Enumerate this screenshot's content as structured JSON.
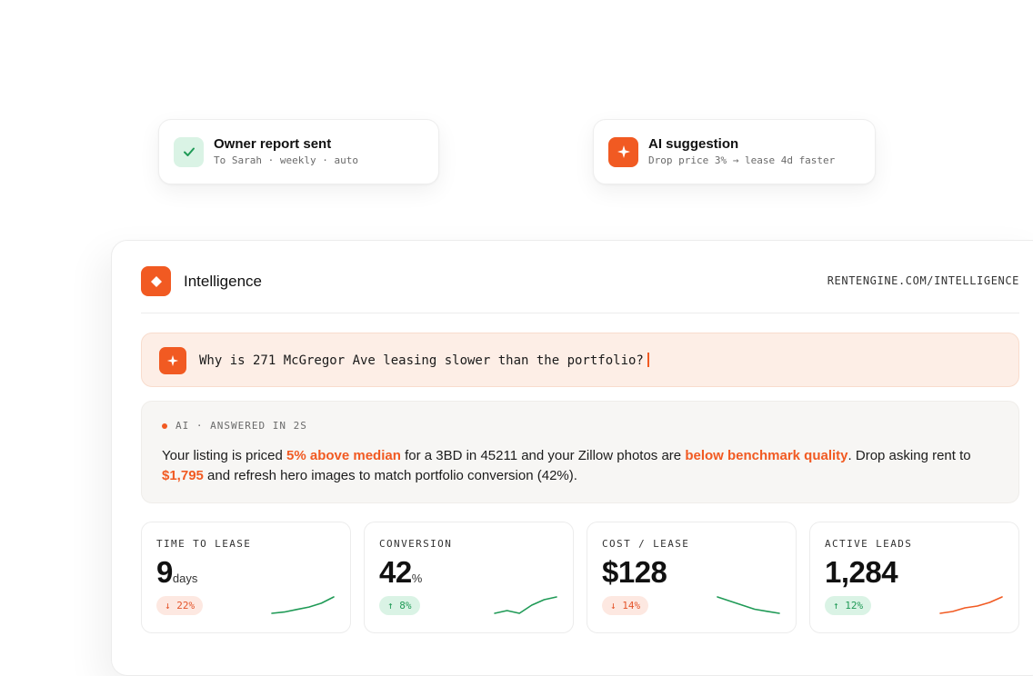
{
  "notifications": {
    "owner_report": {
      "title": "Owner report sent",
      "subtitle": "To Sarah · weekly · auto",
      "icon": "check-icon",
      "accent": "#1f9a56"
    },
    "ai_suggestion": {
      "title": "AI suggestion",
      "subtitle": "Drop price 3% → lease 4d faster",
      "icon": "sparkle-icon",
      "accent": "#f15a22"
    }
  },
  "panel": {
    "brand": "Intelligence",
    "url": "RENTENGINE.COM/INTELLIGENCE",
    "query": "Why is 271 McGregor Ave leasing slower than the portfolio?",
    "answer": {
      "meta": "AI · ANSWERED IN 2S",
      "text_1": "Your listing is priced ",
      "hl_1": "5% above median",
      "text_2": " for a 3BD in 45211 and your Zillow photos are ",
      "hl_2": "below benchmark quality",
      "text_3": ". Drop asking rent to ",
      "hl_3": "$1,795",
      "text_4": " and refresh hero images to match portfolio conversion (42%)."
    }
  },
  "stats": [
    {
      "label": "TIME TO LEASE",
      "value": "9",
      "unit": "days",
      "change": "↓ 22%",
      "direction": "down",
      "spark_color": "#1f9a56",
      "spark": [
        2,
        3,
        5,
        7,
        10,
        15
      ]
    },
    {
      "label": "CONVERSION",
      "value": "42",
      "unit": "%",
      "change": "↑ 8%",
      "direction": "up",
      "spark_color": "#1f9a56",
      "spark": [
        6,
        7,
        6,
        9,
        11,
        12
      ]
    },
    {
      "label": "COST / LEASE",
      "value": "$128",
      "unit": "",
      "change": "↓ 14%",
      "direction": "down",
      "spark_color": "#1f9a56",
      "spark": [
        11,
        9,
        7,
        5,
        4,
        3
      ]
    },
    {
      "label": "ACTIVE LEADS",
      "value": "1,284",
      "unit": "",
      "change": "↑ 12%",
      "direction": "up",
      "spark_color": "#f15a22",
      "spark": [
        2,
        3,
        5,
        6,
        8,
        11
      ]
    }
  ]
}
